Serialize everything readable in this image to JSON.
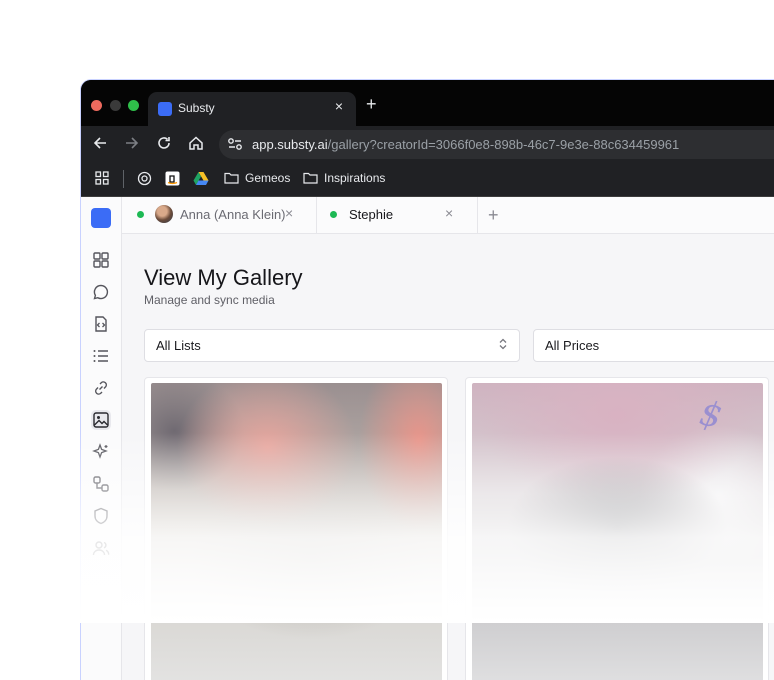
{
  "browser": {
    "tab_title": "Substy",
    "tab_close": "×",
    "new_tab": "+",
    "url_host": "app.substy.ai",
    "url_rest": "/gallery?creatorId=3066f0e8-898b-46c7-9e3e-88c634459961",
    "bookmarks": [
      {
        "label": "Gemeos",
        "icon": "folder-icon"
      },
      {
        "label": "Inspirations",
        "icon": "folder-icon"
      }
    ]
  },
  "conversation_tabs": [
    {
      "label": "Anna (Anna Klein)",
      "status_color": "#1db954",
      "close": "×"
    },
    {
      "label": "Stephie",
      "status_color": "#1db954",
      "close": "×"
    }
  ],
  "conversation_tab_add": "+",
  "page": {
    "title": "View My Gallery",
    "subtitle": "Manage and sync media"
  },
  "filters": {
    "lists": {
      "label": "All Lists"
    },
    "prices": {
      "label": "All Prices"
    }
  },
  "media": [
    {
      "icon": null
    },
    {
      "icon": "price-icon"
    }
  ],
  "price_mark": "$",
  "colors": {
    "brand": "#3b6cf6",
    "online": "#1db954",
    "chrome_dark": "#202124"
  },
  "sidebar_icons": [
    "dashboard-icon",
    "chat-icon",
    "code-icon",
    "list-icon",
    "link-icon",
    "gallery-icon",
    "sparkle-icon",
    "automation-icon",
    "shield-icon",
    "users-icon"
  ]
}
